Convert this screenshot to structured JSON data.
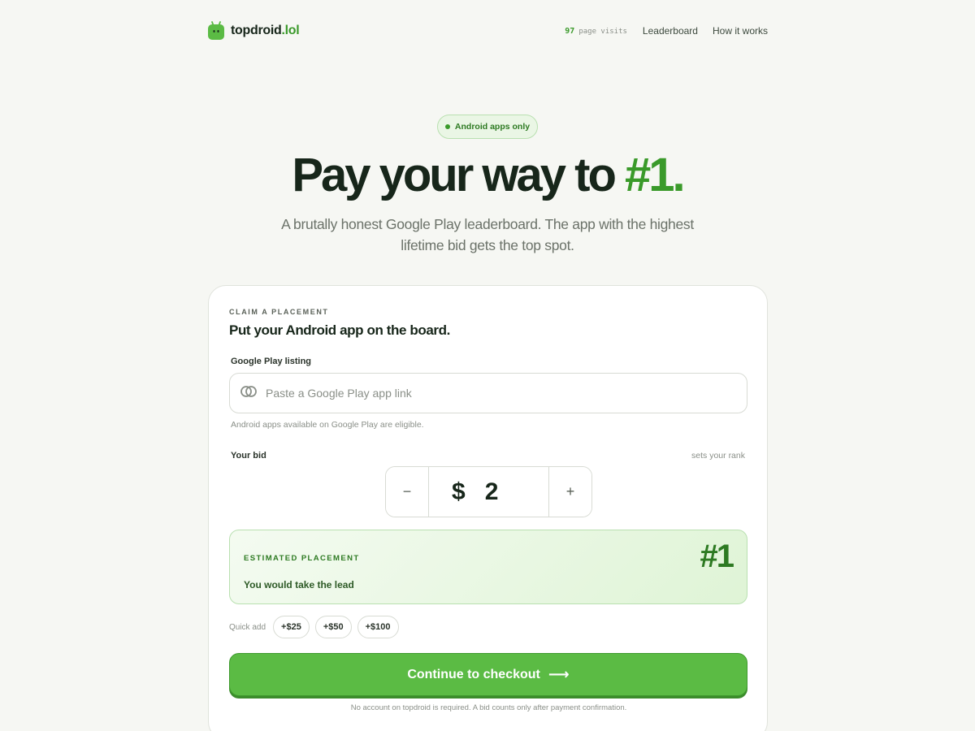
{
  "header": {
    "brand_name": "topdroid",
    "brand_tld": ".lol",
    "visits_count": "97",
    "visits_label": "page visits",
    "nav": [
      "Leaderboard",
      "How it works"
    ]
  },
  "hero": {
    "badge": "Android apps only",
    "title_main": "Pay your way to",
    "title_accent": "#1.",
    "subtitle": "A brutally honest Google Play leaderboard. The app with the highest lifetime bid gets the top spot."
  },
  "card": {
    "eyebrow": "CLAIM A PLACEMENT",
    "title": "Put your Android app on the board.",
    "listing_label": "Google Play listing",
    "listing_placeholder": "Paste a Google Play app link",
    "listing_value": "",
    "listing_helper": "Android apps available on Google Play are eligible.",
    "bid_label": "Your bid",
    "bid_hint": "sets your rank",
    "bid_currency": "$",
    "bid_value": "2",
    "minus": "−",
    "plus": "+",
    "estimate_label": "ESTIMATED PLACEMENT",
    "estimate_desc": "You would take the lead",
    "estimate_rank": "#1",
    "quick_label": "Quick add",
    "quick_chips": [
      "+$25",
      "+$50",
      "+$100"
    ],
    "cta_label": "Continue to checkout",
    "cta_arrow": "⟶",
    "footnote": "No account on topdroid is required. A bid counts only after payment confirmation."
  },
  "colors": {
    "accent": "#3a9a2a",
    "cta": "#5bbb44",
    "background": "#f6f7f3"
  },
  "icons": {
    "logo": "android-robot-icon",
    "listing_field": "link-rings-icon",
    "cta": "arrow-right-icon"
  }
}
